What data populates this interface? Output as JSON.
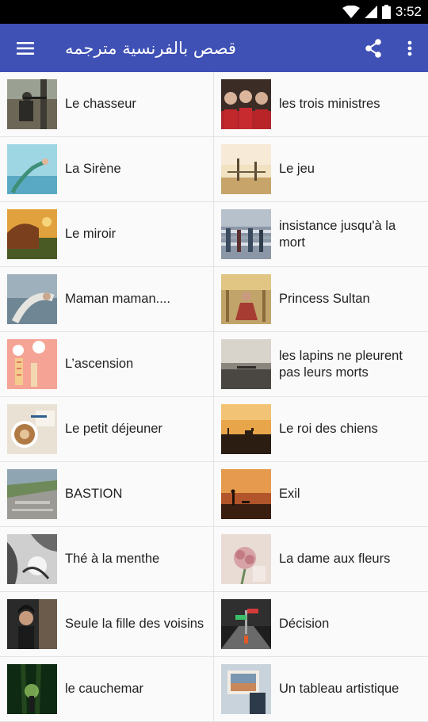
{
  "status_bar": {
    "time": "3:52",
    "icons": [
      "wifi-icon",
      "signal-icon",
      "battery-icon"
    ]
  },
  "app_bar": {
    "title": "قصص بالفرنسية مترجمه",
    "menu_icon": "hamburger-menu-icon",
    "share_icon": "share-icon",
    "overflow_icon": "overflow-menu-icon",
    "color": "#3f51b5"
  },
  "stories": [
    {
      "title": "Le chasseur",
      "thumb": "hunter-image"
    },
    {
      "title": "les trois ministres",
      "thumb": "three-ministers-image"
    },
    {
      "title": "La Sirène",
      "thumb": "mermaid-image"
    },
    {
      "title": "Le jeu",
      "thumb": "game-image"
    },
    {
      "title": "Le miroir",
      "thumb": "mirror-image"
    },
    {
      "title": "insistance jusqu'à la mort",
      "thumb": "insistence-image"
    },
    {
      "title": "Maman maman....",
      "thumb": "maman-image"
    },
    {
      "title": "Princess Sultan",
      "thumb": "princess-image"
    },
    {
      "title": "L’ascension",
      "thumb": "ascension-image"
    },
    {
      "title": "les lapins ne pleurent pas leurs morts",
      "thumb": "rabbits-image"
    },
    {
      "title": "Le petit déjeuner",
      "thumb": "breakfast-image"
    },
    {
      "title": "Le roi des chiens",
      "thumb": "king-dogs-image"
    },
    {
      "title": "BASTION",
      "thumb": "bastion-image"
    },
    {
      "title": "Exil",
      "thumb": "exile-image"
    },
    {
      "title": "Thé à la menthe",
      "thumb": "mint-tea-image"
    },
    {
      "title": "La dame aux fleurs",
      "thumb": "flower-lady-image"
    },
    {
      "title": "Seule la fille des voisins",
      "thumb": "neighbor-girl-image"
    },
    {
      "title": "Décision",
      "thumb": "decision-image"
    },
    {
      "title": "le cauchemar",
      "thumb": "nightmare-image"
    },
    {
      "title": "Un tableau artistique",
      "thumb": "painting-image"
    }
  ]
}
